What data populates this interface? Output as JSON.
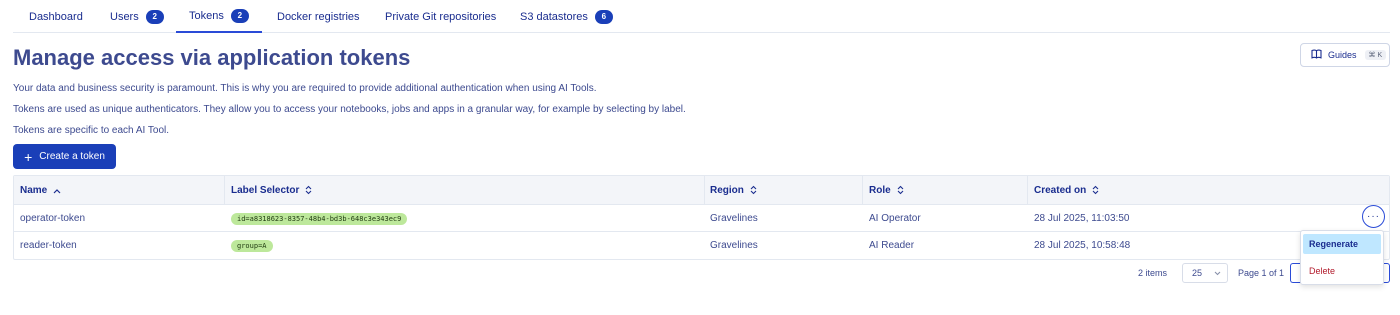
{
  "tabs": [
    {
      "label": "Dashboard"
    },
    {
      "label": "Users",
      "badge": "2"
    },
    {
      "label": "Tokens",
      "badge": "2",
      "active": true
    },
    {
      "label": "Docker registries"
    },
    {
      "label": "Private Git repositories"
    },
    {
      "label": "S3 datastores",
      "badge": "6"
    }
  ],
  "header": {
    "title": "Manage access via application tokens",
    "guides_label": "Guides",
    "guides_shortcut": "⌘ K"
  },
  "descriptions": [
    "Your data and business security is paramount. This is why you are required to provide additional authentication when using AI Tools.",
    "Tokens are used as unique authenticators. They allow you to access your notebooks, jobs and apps in a granular way, for example by selecting by label.",
    "Tokens are specific to each AI Tool."
  ],
  "create_button": {
    "label": "Create a token",
    "icon": "plus-icon"
  },
  "table": {
    "columns": [
      {
        "label": "Name",
        "sort_icon": "sort-ascending-icon"
      },
      {
        "label": "Label Selector",
        "sort_icon": "sort-icon"
      },
      {
        "label": "Region",
        "sort_icon": "sort-icon"
      },
      {
        "label": "Role",
        "sort_icon": "sort-icon"
      },
      {
        "label": "Created on",
        "sort_icon": "sort-icon"
      }
    ],
    "rows": [
      {
        "name": "operator-token",
        "label_selector": "id=a8318623-8357-48b4-bd3b-648c3e343ec9",
        "region": "Gravelines",
        "role": "AI Operator",
        "created_on": "28 Jul 2025, 11:03:50"
      },
      {
        "name": "reader-token",
        "label_selector": "group=A",
        "region": "Gravelines",
        "role": "AI Reader",
        "created_on": "28 Jul 2025, 10:58:48"
      }
    ]
  },
  "action_menu": {
    "more_label": "···",
    "items": [
      {
        "label": "Regenerate"
      },
      {
        "label": "Delete"
      }
    ]
  },
  "pagination": {
    "items_count": "2 items",
    "page_size": "25",
    "page_info": "Page 1 of 1"
  },
  "colors": {
    "accent": "#1a3fb8",
    "tag_bg": "#bde89b",
    "menu_highlight": "#bfe7ff",
    "danger": "#b21b2c"
  }
}
